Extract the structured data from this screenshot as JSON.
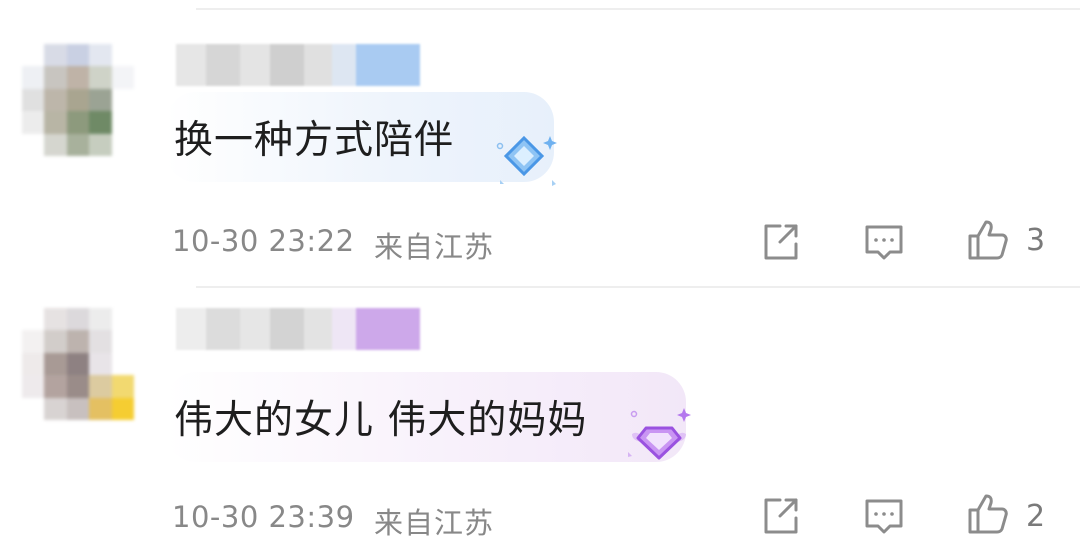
{
  "comments": [
    {
      "text": "换一种方式陪伴",
      "time": "10-30 23:22",
      "location": "来自江苏",
      "likes": "3",
      "badge_color": "#4aa3f0",
      "bubble_color": "#eef5fd"
    },
    {
      "text": "伟大的女儿 伟大的妈妈",
      "time": "10-30 23:39",
      "location": "来自江苏",
      "likes": "2",
      "badge_color": "#b36cf0",
      "bubble_color": "#f6eefb"
    }
  ],
  "icons": {
    "share": "share-icon",
    "reply": "comment-icon",
    "like": "thumbs-up-icon"
  }
}
